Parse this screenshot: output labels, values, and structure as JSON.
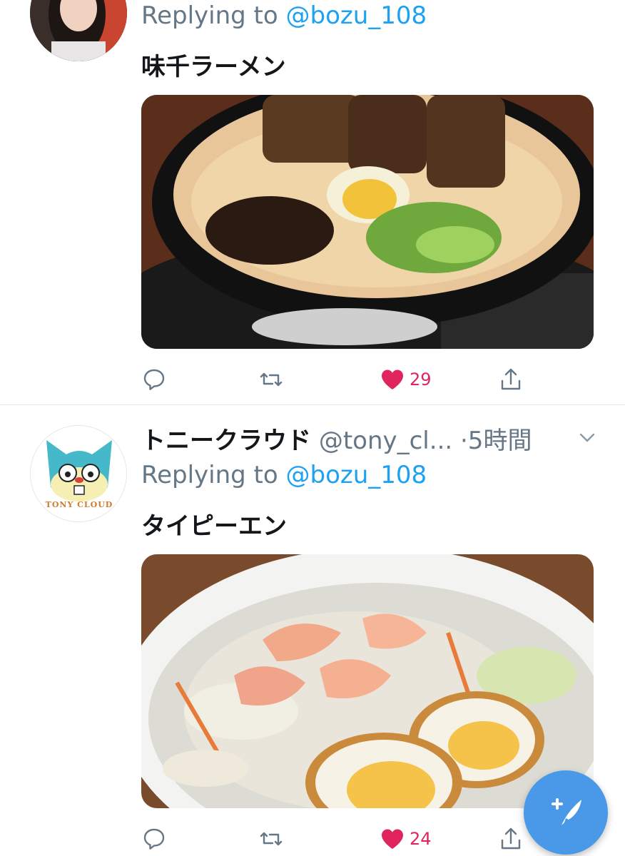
{
  "tweet1": {
    "replying_prefix": "Replying to",
    "replying_handle": "@bozu_108",
    "text": "味千ラーメン",
    "like_count": "29"
  },
  "tweet2": {
    "display_name": "トニークラウド",
    "handle": "@tony_cl...",
    "time": "·5時間",
    "replying_prefix": "Replying to",
    "replying_handle": "@bozu_108",
    "text": "タイピーエン",
    "like_count": "24",
    "avatar_logo_text": "TONY CLOUD"
  },
  "colors": {
    "link": "#1da1f2",
    "like": "#e0245e",
    "muted": "#657786",
    "fab": "#4a99e9"
  },
  "icons": [
    "reply-icon",
    "retweet-icon",
    "heart-icon",
    "share-icon",
    "chevron-down-icon",
    "compose-icon"
  ]
}
